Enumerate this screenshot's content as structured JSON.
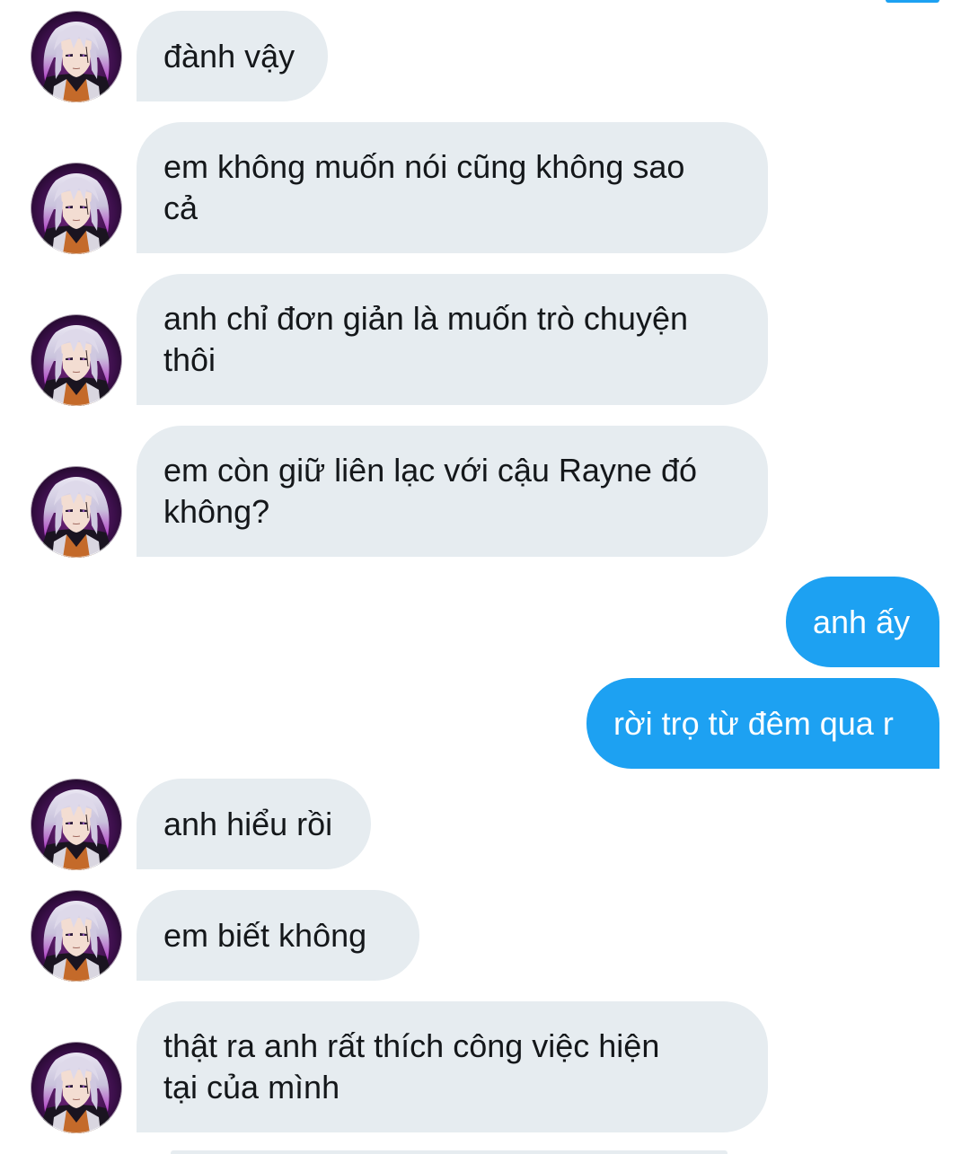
{
  "conversation": {
    "messages": [
      {
        "sender": "other",
        "text": "đành vậy"
      },
      {
        "sender": "other",
        "text": "em không muốn nói cũng không sao\ncả"
      },
      {
        "sender": "other",
        "text": "anh chỉ đơn giản là muốn trò chuyện\nthôi"
      },
      {
        "sender": "other",
        "text": "em còn giữ liên lạc với cậu Rayne đó\nkhông?"
      },
      {
        "sender": "me",
        "text": "anh ấy"
      },
      {
        "sender": "me",
        "text": "rời trọ từ đêm qua r"
      },
      {
        "sender": "other",
        "text": "anh hiểu rồi"
      },
      {
        "sender": "other",
        "text": "em biết không"
      },
      {
        "sender": "other",
        "text": "thật ra anh rất thích công việc hiện\ntại của mình"
      }
    ]
  },
  "colors": {
    "incoming_bubble": "#e6ecf0",
    "outgoing_bubble": "#1da1f2",
    "incoming_text": "#14171a",
    "outgoing_text": "#ffffff"
  },
  "icons": {
    "avatar": "anime-character-avatar-icon"
  }
}
